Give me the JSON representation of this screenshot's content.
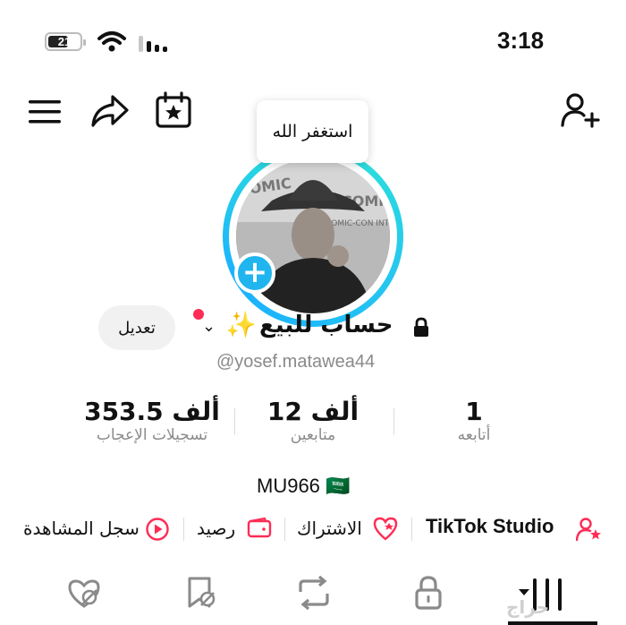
{
  "status_bar": {
    "time": "3:18",
    "battery": "21"
  },
  "top_nav": {
    "icons": [
      "menu-icon",
      "share-icon",
      "calendar-star-icon",
      "add-user-icon"
    ]
  },
  "tooltip": {
    "text": "استغفر الله"
  },
  "profile": {
    "name": "حساب للبيع",
    "sparkle": "✨",
    "handle": "@yosef.matawea44",
    "edit_label": "تعديل",
    "photo_caption": "COMIC-CON INTERNATIONAL"
  },
  "stats": [
    {
      "value": "1",
      "label": "أتابعه"
    },
    {
      "value": "12 ألف",
      "label": "متابعين"
    },
    {
      "value": "353.5 ألف",
      "label": "تسجيلات الإعجاب"
    }
  ],
  "bio": {
    "text": "MU966 🇸🇦"
  },
  "links": {
    "studio": "TikTok Studio",
    "subscription": "الاشتراك",
    "balance": "رصيد",
    "history": "سجل المشاهدة"
  },
  "tabs": [
    "liked-hidden-icon",
    "favorites-icon",
    "repost-icon",
    "lock-icon",
    "grid-icon"
  ],
  "watermark": "حراج",
  "colors": {
    "accent": "#fe2c55",
    "ring": "#20b5ef",
    "muted": "#8a8a8a"
  }
}
